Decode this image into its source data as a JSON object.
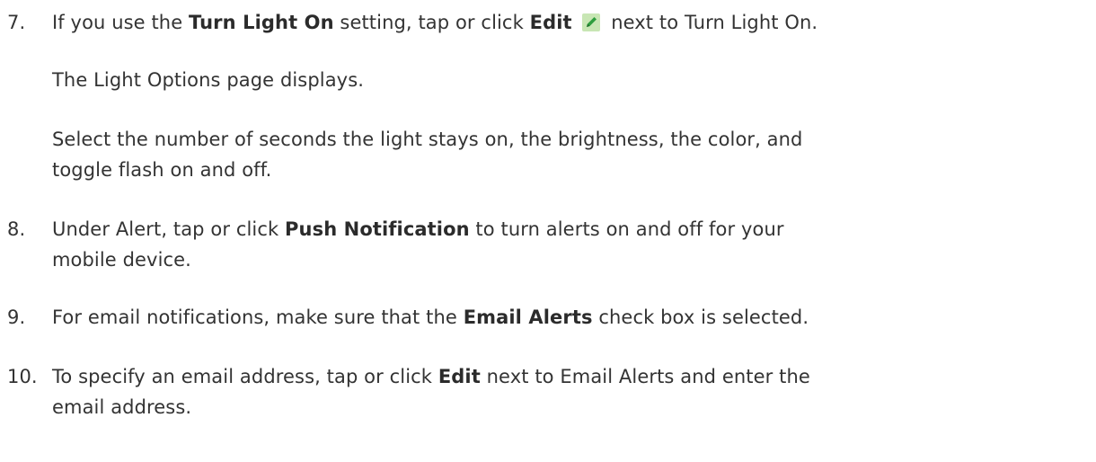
{
  "steps": [
    {
      "number": "7.",
      "pre": "If you use the ",
      "bold1": "Turn Light On",
      "mid": " setting, tap or click ",
      "bold2": "Edit",
      "icon": "edit-pencil-icon",
      "post": " next to Turn Light On."
    },
    {
      "para1": "The Light Options page displays.",
      "para2_line1": "Select the number of seconds the light stays on, the brightness, the color, and",
      "para2_line2": "toggle flash on and off."
    },
    {
      "number": "8.",
      "pre": "Under Alert, tap or click ",
      "bold1": "Push Notification",
      "post_line1": " to turn alerts on and off for your",
      "line2": "mobile device."
    },
    {
      "number": "9.",
      "pre": "For email notifications,  make sure that the ",
      "bold1": "Email Alerts",
      "post": " check box is selected."
    },
    {
      "number": "10.",
      "pre": "To specify an email address, tap or click ",
      "bold1": "Edit",
      "post_line1": " next to Email Alerts and enter the",
      "line2": "email address."
    }
  ],
  "colors": {
    "text": "#333333",
    "icon_bg": "#c8e6b4",
    "icon_pencil": "#2e9e3e"
  }
}
